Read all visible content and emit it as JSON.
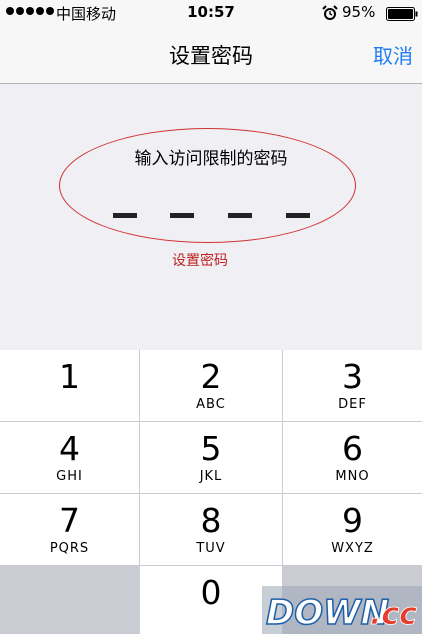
{
  "status_bar": {
    "carrier": "中国移动",
    "time": "10:57",
    "battery": "95%",
    "alarm_icon": "alarm-clock-icon",
    "signal_icon": "signal-dots-icon",
    "battery_icon": "battery-icon"
  },
  "nav": {
    "title": "设置密码",
    "cancel": "取消",
    "accent_color": "#1f7ef5"
  },
  "passcode": {
    "prompt": "输入访问限制的密码",
    "digits_entered": 0,
    "digit_slots": 4,
    "annotation": "设置密码",
    "annotation_color": "#c02020"
  },
  "keypad": {
    "keys": [
      {
        "num": "1",
        "letters": ""
      },
      {
        "num": "2",
        "letters": "ABC"
      },
      {
        "num": "3",
        "letters": "DEF"
      },
      {
        "num": "4",
        "letters": "GHI"
      },
      {
        "num": "5",
        "letters": "JKL"
      },
      {
        "num": "6",
        "letters": "MNO"
      },
      {
        "num": "7",
        "letters": "PQRS"
      },
      {
        "num": "8",
        "letters": "TUV"
      },
      {
        "num": "9",
        "letters": "WXYZ"
      },
      {
        "num": "",
        "letters": ""
      },
      {
        "num": "0",
        "letters": ""
      },
      {
        "num": "",
        "letters": ""
      }
    ]
  },
  "watermark": {
    "text_main": "DOWN",
    "text_suffix": ".cc"
  }
}
